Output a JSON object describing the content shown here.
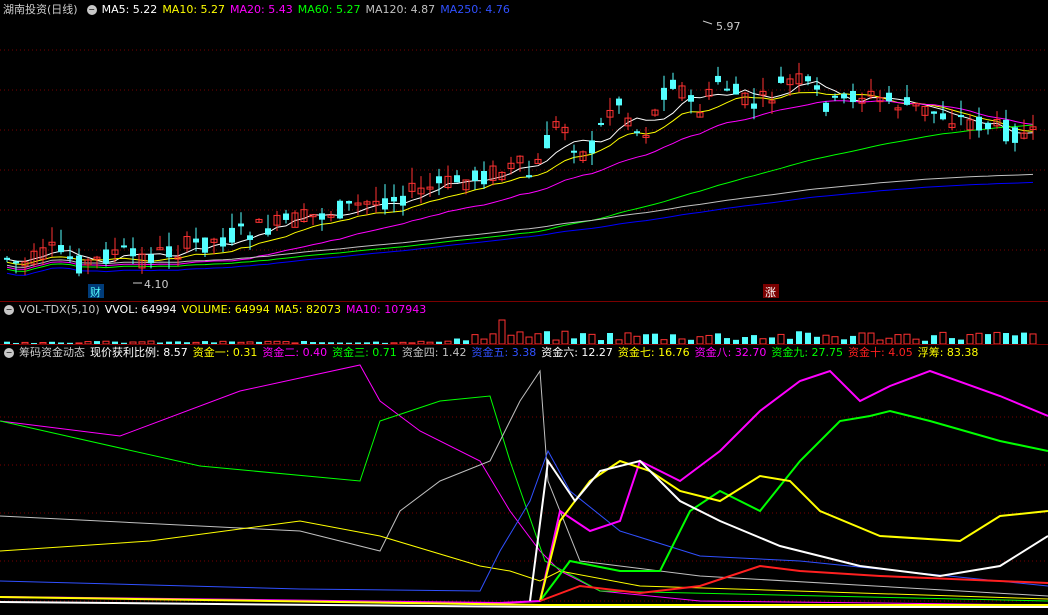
{
  "colors": {
    "up": "#ff3232",
    "down": "#54ffff",
    "ma5": "#ffffff",
    "ma10": "#ffff00",
    "ma20": "#ff00ff",
    "ma60": "#00ff00",
    "ma120": "#c0c0c0",
    "ma250": "#0000ff",
    "grid": "#7a0000"
  },
  "price_panel": {
    "icon": "circle-minus-icon",
    "title": "湖南投资(日线)",
    "ma": [
      {
        "label": "MA5: 5.22",
        "color": "#ffffff"
      },
      {
        "label": "MA10: 5.27",
        "color": "#ffff00"
      },
      {
        "label": "MA20: 5.43",
        "color": "#ff00ff"
      },
      {
        "label": "MA60: 5.27",
        "color": "#00ff00"
      },
      {
        "label": "MA120: 4.87",
        "color": "#c0c0c0"
      },
      {
        "label": "MA250: 4.76",
        "color": "#3050ff"
      }
    ],
    "high_marker": "5.97",
    "low_marker": "4.10",
    "tag_cai": "财",
    "tag_zhang": "涨"
  },
  "volume_panel": {
    "icon": "circle-minus-icon",
    "title": "VOL-TDX(5,10)",
    "items": [
      {
        "label": "VVOL: 64994",
        "color": "#ffffff"
      },
      {
        "label": "VOLUME: 64994",
        "color": "#ffff00"
      },
      {
        "label": "MA5: 82073",
        "color": "#ffff00"
      },
      {
        "label": "MA10: 107943",
        "color": "#ff00ff"
      }
    ]
  },
  "chip_panel": {
    "icon": "circle-minus-icon",
    "title": "筹码资金动态",
    "items": [
      {
        "label": "现价获利比例: 8.57",
        "color": "#ffffff"
      },
      {
        "label": "资金一: 0.31",
        "color": "#ffff00"
      },
      {
        "label": "资金二: 0.40",
        "color": "#ff00ff"
      },
      {
        "label": "资金三: 0.71",
        "color": "#00ff00"
      },
      {
        "label": "资金四: 1.42",
        "color": "#c0c0c0"
      },
      {
        "label": "资金五: 3.38",
        "color": "#3050ff"
      },
      {
        "label": "资金六: 12.27",
        "color": "#ffffff"
      },
      {
        "label": "资金七: 16.76",
        "color": "#ffff00"
      },
      {
        "label": "资金八: 32.70",
        "color": "#ff00ff"
      },
      {
        "label": "资金九: 27.75",
        "color": "#00ff00"
      },
      {
        "label": "资金十: 4.05",
        "color": "#ff2020"
      },
      {
        "label": "浮筹: 83.38",
        "color": "#ffff00"
      }
    ]
  }
}
